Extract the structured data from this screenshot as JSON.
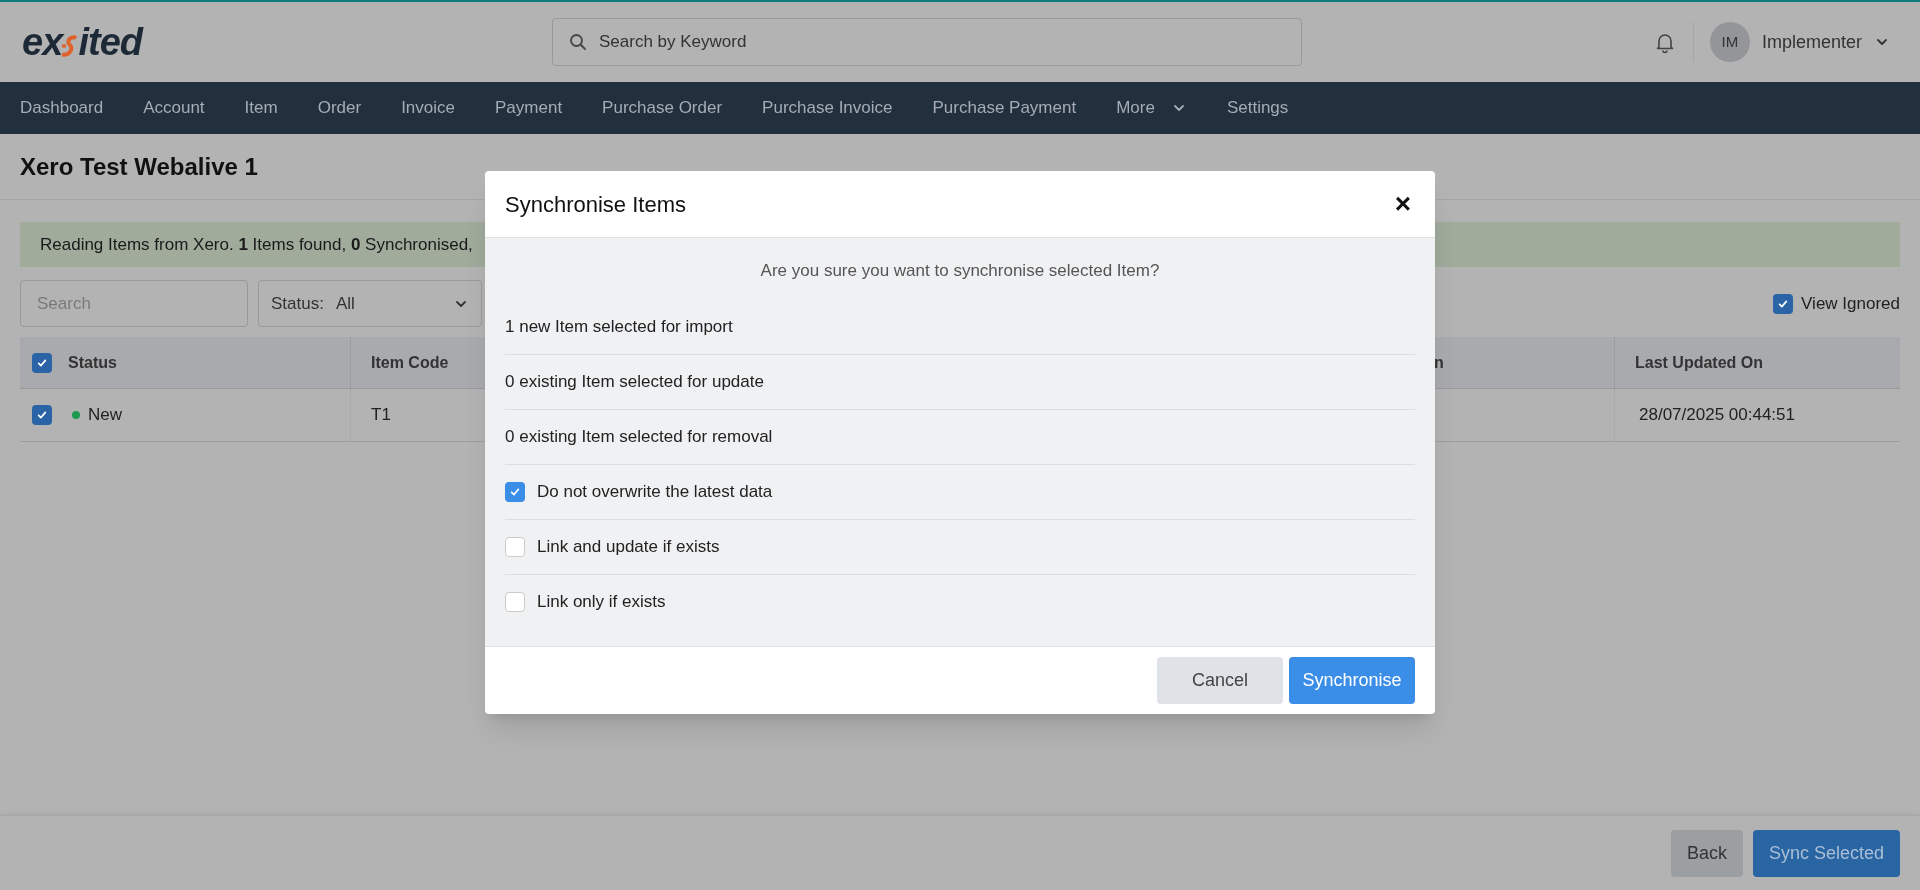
{
  "header": {
    "logo": {
      "start": "ex",
      "end": "ited"
    },
    "search": {
      "placeholder": "Search by Keyword"
    },
    "user": {
      "initials": "IM",
      "name": "Implementer"
    }
  },
  "nav": [
    {
      "label": "Dashboard"
    },
    {
      "label": "Account"
    },
    {
      "label": "Item"
    },
    {
      "label": "Order"
    },
    {
      "label": "Invoice"
    },
    {
      "label": "Payment"
    },
    {
      "label": "Purchase Order"
    },
    {
      "label": "Purchase Invoice"
    },
    {
      "label": "Purchase Payment"
    },
    {
      "label": "More",
      "dropdown": true
    },
    {
      "label": "Settings"
    }
  ],
  "page_title": "Xero Test Webalive 1",
  "alert": "Reading Items from Xero. **1** Items found, **0** Synchronised,",
  "filters": {
    "search": {
      "placeholder": "Search"
    },
    "status": {
      "label": "Status:",
      "value": "All"
    },
    "view_ignored": {
      "label": "View Ignored",
      "checked": true
    }
  },
  "table": {
    "select_all": true,
    "columns": [
      "Status",
      "Item Code",
      "n",
      "Last Updated On"
    ],
    "rows": [
      {
        "checked": true,
        "color": "#1e9a50",
        "cells": [
          "New",
          "T1",
          "",
          "28/07/2025 00:44:51"
        ]
      }
    ]
  },
  "footer": {
    "buttons": [
      "Back",
      "Sync Selected"
    ]
  },
  "dialog": {
    "title": "Synchronise Items",
    "close": "×",
    "question": "Are you sure you want to synchronise selected Item?",
    "rows": [
      {
        "kind": "text",
        "label": "1 new Item selected for import"
      },
      {
        "kind": "text",
        "label": "0 existing Item selected for update"
      },
      {
        "kind": "text",
        "label": "0 existing Item selected for removal"
      },
      {
        "kind": "checkbox",
        "label": "Do not overwrite the latest data",
        "checked": true
      },
      {
        "kind": "checkbox",
        "label": "Link and update if exists",
        "checked": false
      },
      {
        "kind": "checkbox",
        "label": "Link only if exists",
        "checked": false
      }
    ],
    "buttons": [
      {
        "label": "Cancel",
        "kind": "secondary"
      },
      {
        "label": "Synchronise",
        "kind": "primary"
      }
    ]
  }
}
